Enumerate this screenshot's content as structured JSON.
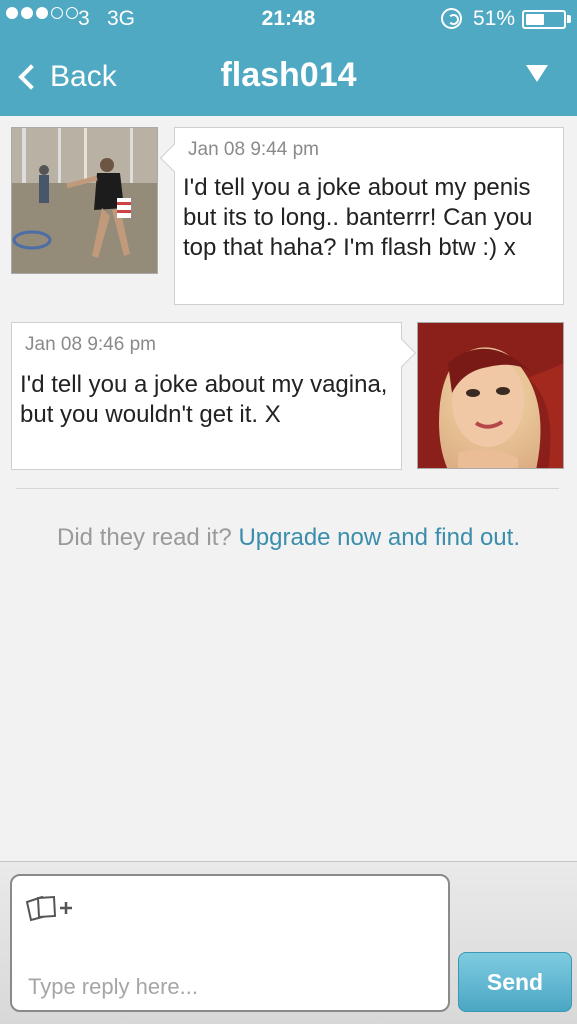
{
  "status_bar": {
    "carrier": "3",
    "network": "3G",
    "time": "21:48",
    "battery": "51%",
    "battery_level": 0.51
  },
  "nav": {
    "back_label": "Back",
    "title": "flash014",
    "menu_icon": "triangle-down-icon"
  },
  "messages": [
    {
      "side": "left",
      "timestamp": "Jan 08 9:44 pm",
      "text": "I'd tell you a joke about my penis but its to long.. banterrr! Can you top that haha? I'm flash btw :) x"
    },
    {
      "side": "right",
      "timestamp": "Jan 08 9:46 pm",
      "text": "I'd tell you a joke about my vagina, but you wouldn't get it. X"
    }
  ],
  "read_receipt": {
    "prompt": "Did they read it?",
    "link": "Upgrade now and find out."
  },
  "composer": {
    "placeholder": "Type reply here...",
    "send_label": "Send",
    "attach_icon": "add-photo-icon"
  },
  "colors": {
    "header": "#4fa9c2",
    "link": "#3a8eab",
    "send": "#4aa7c4"
  }
}
